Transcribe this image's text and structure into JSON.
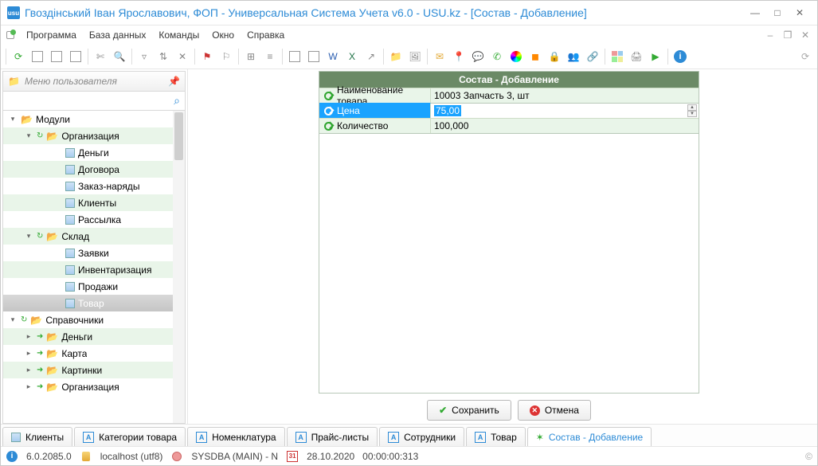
{
  "title": "Гвоздінський Іван Ярославович, ФОП - Универсальная Система Учета v6.0 - USU.kz - [Состав - Добавление]",
  "menu": {
    "program": "Программа",
    "db": "База данных",
    "cmd": "Команды",
    "win": "Окно",
    "help": "Справка"
  },
  "sidebar": {
    "header": "Меню пользователя",
    "nodes": [
      {
        "lvl": 0,
        "type": "folder",
        "exp": "down",
        "label": "Модули",
        "striped": false
      },
      {
        "lvl": 1,
        "type": "folder",
        "exp": "down",
        "label": "Организация",
        "striped": true,
        "arrow": true
      },
      {
        "lvl": 2,
        "type": "page",
        "label": "Деньги",
        "striped": false
      },
      {
        "lvl": 2,
        "type": "page",
        "label": "Договора",
        "striped": true
      },
      {
        "lvl": 2,
        "type": "page",
        "label": "Заказ-наряды",
        "striped": false
      },
      {
        "lvl": 2,
        "type": "page",
        "label": "Клиенты",
        "striped": true
      },
      {
        "lvl": 2,
        "type": "page",
        "label": "Рассылка",
        "striped": false
      },
      {
        "lvl": 1,
        "type": "folder",
        "exp": "down",
        "label": "Склад",
        "striped": true,
        "arrow": true
      },
      {
        "lvl": 2,
        "type": "page",
        "label": "Заявки",
        "striped": false
      },
      {
        "lvl": 2,
        "type": "page",
        "label": "Инвентаризация",
        "striped": true
      },
      {
        "lvl": 2,
        "type": "page",
        "label": "Продажи",
        "striped": false
      },
      {
        "lvl": 2,
        "type": "page",
        "label": "Товар",
        "striped": true,
        "sel": true
      },
      {
        "lvl": 0,
        "type": "folder",
        "exp": "down",
        "label": "Справочники",
        "striped": false,
        "arrow": true
      },
      {
        "lvl": 1,
        "type": "folder",
        "exp": "right",
        "label": "Деньги",
        "striped": true,
        "green": true
      },
      {
        "lvl": 1,
        "type": "folder",
        "exp": "right",
        "label": "Карта",
        "striped": false,
        "green": true
      },
      {
        "lvl": 1,
        "type": "folder",
        "exp": "right",
        "label": "Картинки",
        "striped": true,
        "green": true
      },
      {
        "lvl": 1,
        "type": "folder",
        "exp": "right",
        "label": "Организация",
        "striped": false,
        "green": true
      }
    ]
  },
  "form": {
    "title": "Состав - Добавление",
    "rows": [
      {
        "label": "Наименование товара",
        "value": "10003 Запчасть 3, шт"
      },
      {
        "label": "Цена",
        "value": "75,00",
        "active": true
      },
      {
        "label": "Количество",
        "value": "100,000"
      }
    ],
    "save": "Сохранить",
    "cancel": "Отмена"
  },
  "tabs": [
    {
      "label": "Клиенты",
      "icon": "page"
    },
    {
      "label": "Категории товара",
      "icon": "A"
    },
    {
      "label": "Номенклатура",
      "icon": "A"
    },
    {
      "label": "Прайс-листы",
      "icon": "A"
    },
    {
      "label": "Сотрудники",
      "icon": "A"
    },
    {
      "label": "Товар",
      "icon": "A"
    },
    {
      "label": "Состав - Добавление",
      "icon": "star",
      "active": true
    }
  ],
  "status": {
    "version": "6.0.2085.0",
    "host": "localhost (utf8)",
    "user": "SYSDBA (MAIN) - N",
    "date": "28.10.2020",
    "time": "00:00:00:313",
    "cal": "31"
  }
}
